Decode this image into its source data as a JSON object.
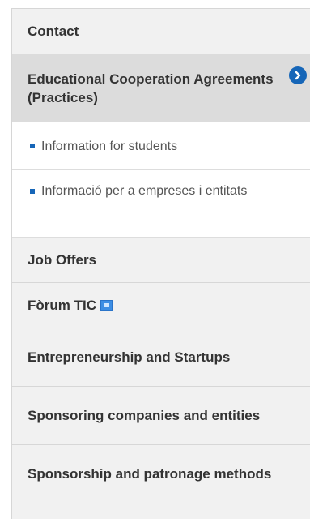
{
  "sidebar": {
    "items": [
      {
        "label": "Contact"
      },
      {
        "label": "Educational Cooperation Agreements (Practices)",
        "expanded": true,
        "toggle_icon": "chevron-right-circle-icon"
      },
      {
        "label": "Job Offers"
      },
      {
        "label": "Fòrum TIC",
        "icon": "external-link-icon"
      },
      {
        "label": "Entrepreneurship and Startups"
      },
      {
        "label": "Sponsoring companies and entities"
      },
      {
        "label": "Sponsorship and patronage methods"
      }
    ],
    "subitems": [
      {
        "label": "Information for students"
      },
      {
        "label": "Informació per a empreses i entitats"
      }
    ]
  },
  "colors": {
    "accent": "#1666b8",
    "active_background": "#dcdcdc",
    "item_background": "#f1f1f1"
  }
}
